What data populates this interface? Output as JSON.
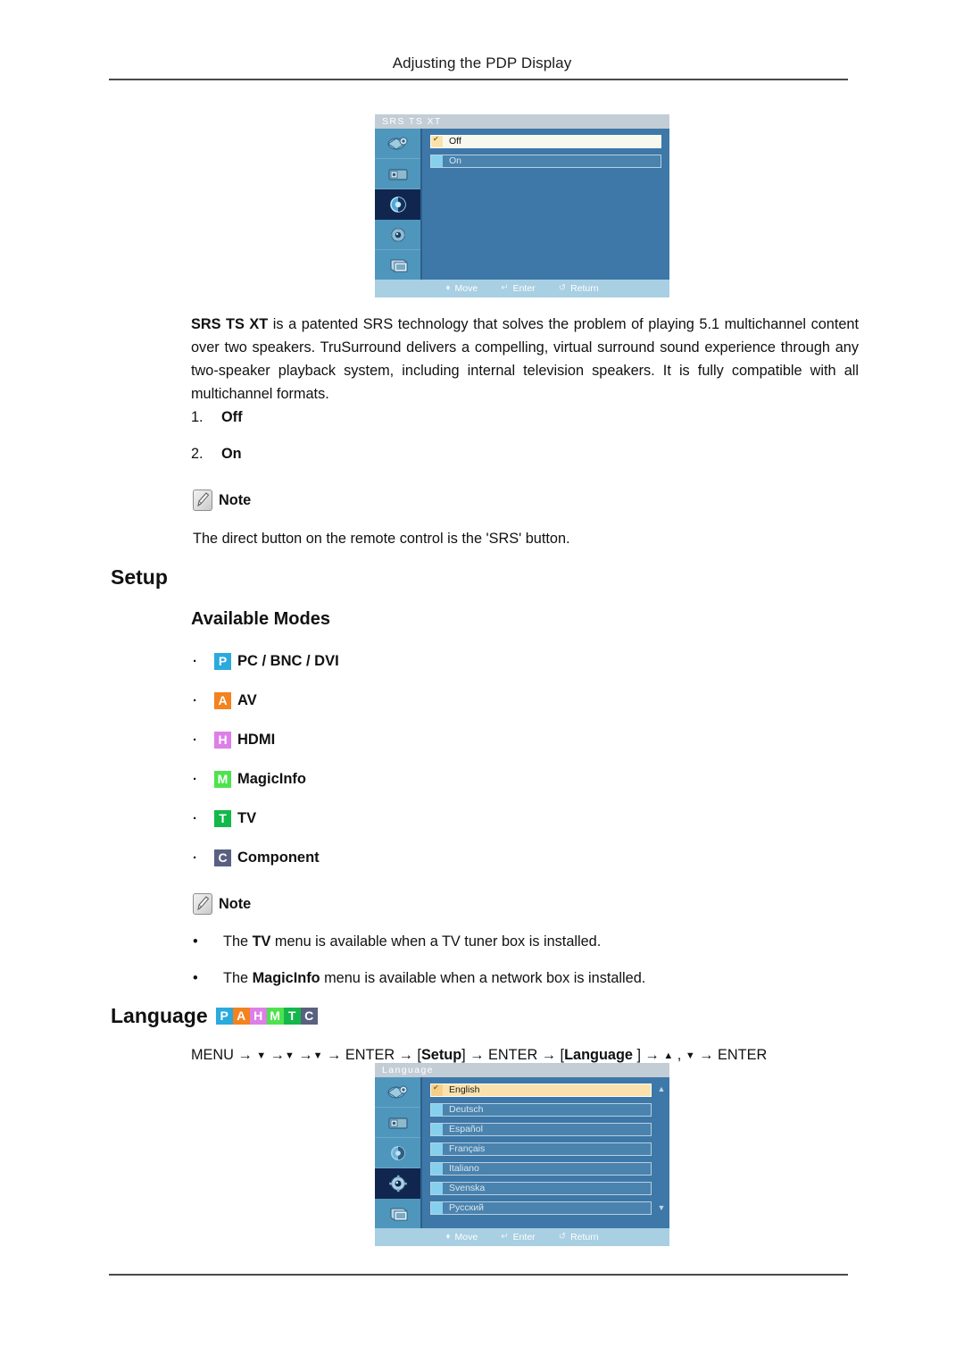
{
  "header": {
    "title": "Adjusting the PDP Display"
  },
  "osd_srs": {
    "title": "SRS TS XT",
    "sidebar_icons": [
      "picture-icon",
      "image-size-icon",
      "sound-icon",
      "setup-gear-icon",
      "multi-control-icon"
    ],
    "active_sidebar_index": 2,
    "rows": [
      {
        "label": "Off",
        "selected": true
      },
      {
        "label": "On",
        "selected": false
      }
    ],
    "footer": [
      {
        "icon": "move-icon",
        "glyph": "♦",
        "label": "Move"
      },
      {
        "icon": "enter-icon",
        "glyph": "↵",
        "label": "Enter"
      },
      {
        "icon": "return-icon",
        "glyph": "↺",
        "label": "Return"
      }
    ]
  },
  "srs_paragraph": "SRS TS XT is a patented SRS technology that solves the problem of playing 5.1 multichannel content over two speakers. TruSurround delivers a compelling, virtual surround sound experience through any two-speaker playback system, including internal television speakers. It is fully compatible with all multichannel formats.",
  "srs_paragraph_lead": "SRS TS XT",
  "srs_paragraph_rest": " is a patented SRS technology that solves the problem of playing 5.1 multichannel content over two speakers. TruSurround delivers a compelling, virtual surround sound experience through any two-speaker playback system, including internal television speakers. It is fully compatible with all multichannel formats.",
  "srs_options": [
    {
      "num": "1.",
      "label": "Off"
    },
    {
      "num": "2.",
      "label": "On"
    }
  ],
  "note_1": {
    "icon": "note-pencil-icon",
    "label": "Note",
    "text": "The direct button on the remote control is the 'SRS' button."
  },
  "setup_heading": "Setup",
  "available_modes_heading": "Available Modes",
  "modes": [
    {
      "badge": "P",
      "color": "#2aaadd",
      "label": "PC / BNC / DVI"
    },
    {
      "badge": "A",
      "color": "#f3821f",
      "label": "AV"
    },
    {
      "badge": "H",
      "color": "#dd7fe8",
      "label": "HDMI"
    },
    {
      "badge": "M",
      "color": "#4ee24e",
      "label": "MagicInfo"
    },
    {
      "badge": "T",
      "color": "#14b84a",
      "label": "TV"
    },
    {
      "badge": "C",
      "color": "#5a6080",
      "label": "Component"
    }
  ],
  "note_2": {
    "icon": "note-pencil-icon",
    "label": "Note",
    "bullets": [
      {
        "pre": "The ",
        "bold": "TV",
        "post": " menu is available when a TV tuner box is installed."
      },
      {
        "pre": "The ",
        "bold": "MagicInfo",
        "post": " menu is available when a network box is installed."
      }
    ]
  },
  "language_heading": "Language",
  "language_badges": [
    {
      "badge": "P",
      "color": "#2aaadd"
    },
    {
      "badge": "A",
      "color": "#f3821f"
    },
    {
      "badge": "H",
      "color": "#dd7fe8"
    },
    {
      "badge": "M",
      "color": "#4ee24e"
    },
    {
      "badge": "T",
      "color": "#14b84a"
    },
    {
      "badge": "C",
      "color": "#5a6080"
    }
  ],
  "menu_path": {
    "full": "MENU → ▼ →▼ →▼ → ENTER → [Setup] → ENTER → [Language ] → ▲ , ▼ → ENTER",
    "segments": [
      "MENU",
      "ENTER",
      "[Setup]",
      "ENTER",
      "[Language ]",
      "ENTER"
    ]
  },
  "osd_language": {
    "title": "Language",
    "sidebar_icons": [
      "picture-icon",
      "image-size-icon",
      "sound-icon",
      "setup-gear-icon",
      "multi-control-icon"
    ],
    "active_sidebar_index": 3,
    "rows": [
      {
        "label": "English",
        "selected": true
      },
      {
        "label": "Deutsch",
        "selected": false
      },
      {
        "label": "Español",
        "selected": false
      },
      {
        "label": "Français",
        "selected": false
      },
      {
        "label": "Italiano",
        "selected": false
      },
      {
        "label": "Svenska",
        "selected": false
      },
      {
        "label": "Русский",
        "selected": false
      }
    ],
    "scroll": {
      "up": "▲",
      "down": "▼"
    },
    "footer": [
      {
        "icon": "move-icon",
        "glyph": "♦",
        "label": "Move"
      },
      {
        "icon": "enter-icon",
        "glyph": "↵",
        "label": "Enter"
      },
      {
        "icon": "return-icon",
        "glyph": "↺",
        "label": "Return"
      }
    ]
  }
}
